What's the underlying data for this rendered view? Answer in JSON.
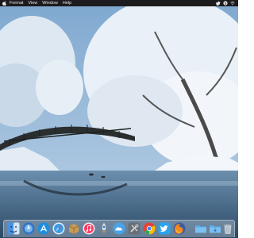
{
  "menubar": {
    "apple_icon": "apple-logo-icon",
    "items": [
      "Format",
      "View",
      "Window",
      "Help"
    ],
    "tray_icons": [
      "twitter-icon",
      "skype-icon",
      "wifi-icon"
    ]
  },
  "wallpaper": {
    "subject": "snow-covered trees and footbridge over a lake",
    "colors": {
      "sky": "#8fb4d8",
      "snow": "#eef3f8",
      "water": "#3d5f7e",
      "bridge": "#2b2e2e"
    }
  },
  "dock": {
    "items": [
      {
        "name": "finder-icon"
      },
      {
        "name": "launchpad-icon"
      },
      {
        "name": "app-store-icon"
      },
      {
        "name": "safari-icon"
      },
      {
        "name": "cardboard-box-icon"
      },
      {
        "name": "itunes-icon"
      },
      {
        "name": "rocket-icon"
      },
      {
        "name": "cloud-icon"
      },
      {
        "name": "tools-icon"
      },
      {
        "name": "chrome-icon"
      },
      {
        "name": "twitter-bird-icon"
      },
      {
        "name": "firefox-icon"
      },
      {
        "name": "folder-icon"
      },
      {
        "name": "downloads-folder-icon"
      },
      {
        "name": "trash-icon"
      }
    ]
  }
}
